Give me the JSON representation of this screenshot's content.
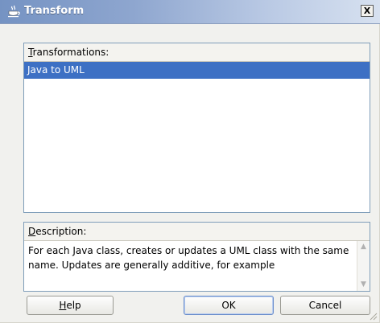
{
  "window": {
    "title": "Transform",
    "close_glyph": "X"
  },
  "transformations": {
    "header_mnemonic": "T",
    "header_rest": "ransformations:",
    "items": [
      {
        "label": "Java to UML",
        "selected": true
      }
    ]
  },
  "description": {
    "header_mnemonic": "D",
    "header_rest": "escription:",
    "text": "For each Java class, creates or updates a UML class with the same name. Updates are generally additive, for example"
  },
  "buttons": {
    "help_mnemonic": "H",
    "help_rest": "elp",
    "ok": "OK",
    "cancel": "Cancel"
  },
  "colors": {
    "selection": "#3d70c4",
    "titlebar_start": "#7593c3",
    "titlebar_end": "#d7e1f0"
  },
  "icons": {
    "title": "java-cup-icon",
    "scroll_up": "scroll-up-arrow-icon",
    "scroll_down": "scroll-down-arrow-icon",
    "resize": "resize-grip-icon"
  }
}
